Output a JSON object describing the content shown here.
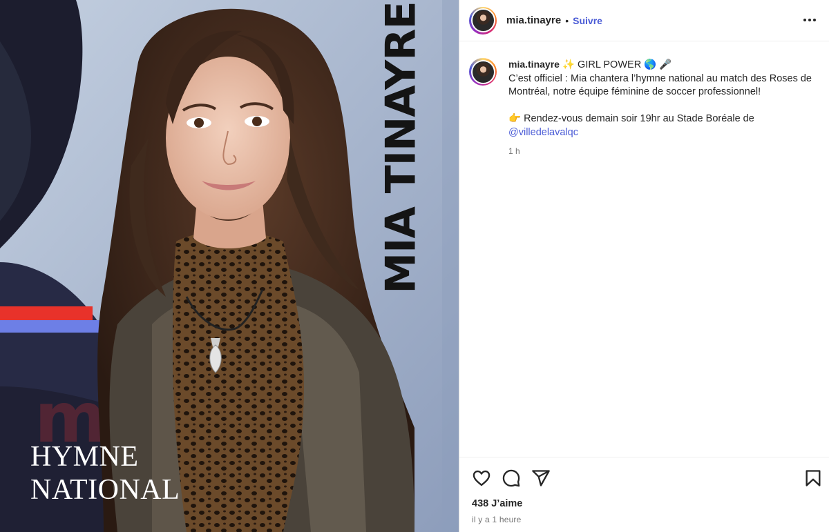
{
  "post_image": {
    "vertical_name": "MIA TINAYRE",
    "title_line1": "HYMNE",
    "title_line2": "NATIONAL",
    "colors": {
      "background_dark": "#1a1b2a",
      "sky_blue": "#aab8d2",
      "stripe_red": "#e8322a",
      "stripe_blue": "#6d7fe6",
      "navy_shape": "#272a45"
    }
  },
  "header": {
    "username": "mia.tinayre",
    "separator": "•",
    "follow_label": "Suivre",
    "more_icon": "more-horizontal-icon"
  },
  "caption": {
    "username": "mia.tinayre",
    "line1_rest": " ✨ GIRL POWER 🌎 🎤",
    "line2": "C’est officiel : Mia chantera l’hymne national au match des Roses de Montréal, notre équipe féminine de soccer professionnel!",
    "line3": "👉 Rendez-vous demain soir 19hr au Stade Boréale de",
    "mention": "@villedelavalqc",
    "time": "1 h"
  },
  "actions": {
    "like_icon": "heart-icon",
    "comment_icon": "comment-icon",
    "share_icon": "share-icon",
    "save_icon": "bookmark-icon"
  },
  "likes_text": "438 J’aime",
  "posted_text": "il y a 1 heure",
  "accent_color": "#4a5bd6"
}
